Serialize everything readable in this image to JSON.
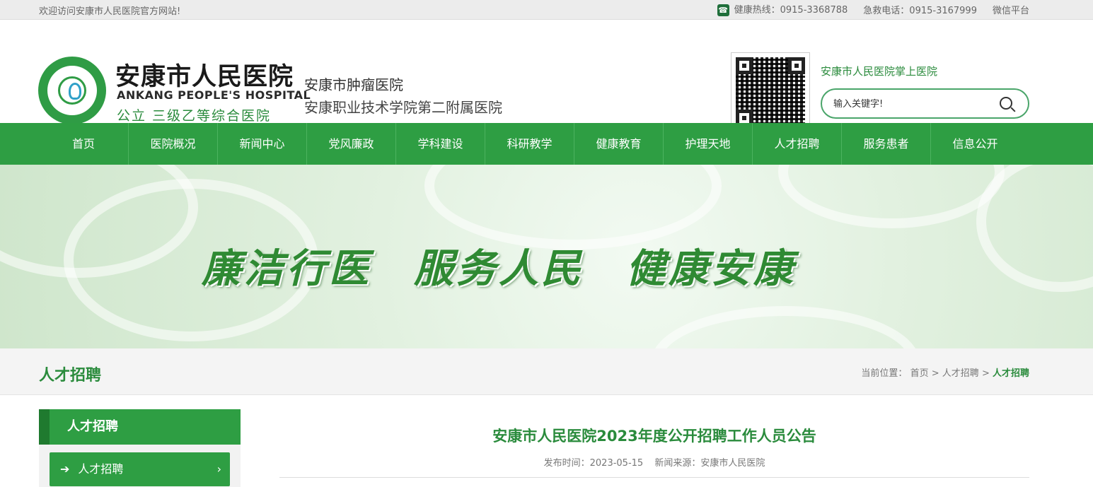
{
  "topbar": {
    "welcome": "欢迎访问安康市人民医院官方网站!",
    "hotline": "健康热线：0915-3368788",
    "emergency": "急救电话：0915-3167999",
    "wechat": "微信平台"
  },
  "header": {
    "cn_name": "安康市人民医院",
    "en_name": "ANKANG PEOPLE'S HOSPITAL",
    "slogan": "公立 三级乙等综合医院",
    "alt_name_1": "安康市肿瘤医院",
    "alt_name_2": "安康职业技术学院第二附属医院",
    "mobile_label": "安康市人民医院掌上医院",
    "search_placeholder": "输入关键字!"
  },
  "nav": {
    "items": [
      {
        "label": "首页"
      },
      {
        "label": "医院概况"
      },
      {
        "label": "新闻中心"
      },
      {
        "label": "党风廉政"
      },
      {
        "label": "学科建设"
      },
      {
        "label": "科研教学"
      },
      {
        "label": "健康教育"
      },
      {
        "label": "护理天地"
      },
      {
        "label": "人才招聘"
      },
      {
        "label": "服务患者"
      },
      {
        "label": "信息公开"
      }
    ]
  },
  "banner": {
    "slogan": "廉洁行医　服务人民　健康安康"
  },
  "breadcrumb": {
    "section_title": "人才招聘",
    "prefix": "当前位置：",
    "home": "首页",
    "sep": ">",
    "parent": "人才招聘",
    "current": "人才招聘"
  },
  "sidebar": {
    "heading": "人才招聘",
    "items": [
      {
        "label": "人才招聘"
      }
    ]
  },
  "article": {
    "title": "安康市人民医院2023年度公开招聘工作人员公告",
    "publish_time": "发布时间：2023-05-15",
    "source": "新闻来源：安康市人民医院"
  },
  "colors": {
    "brand_green": "#2e9e43",
    "text_green": "#2a8b3c"
  }
}
